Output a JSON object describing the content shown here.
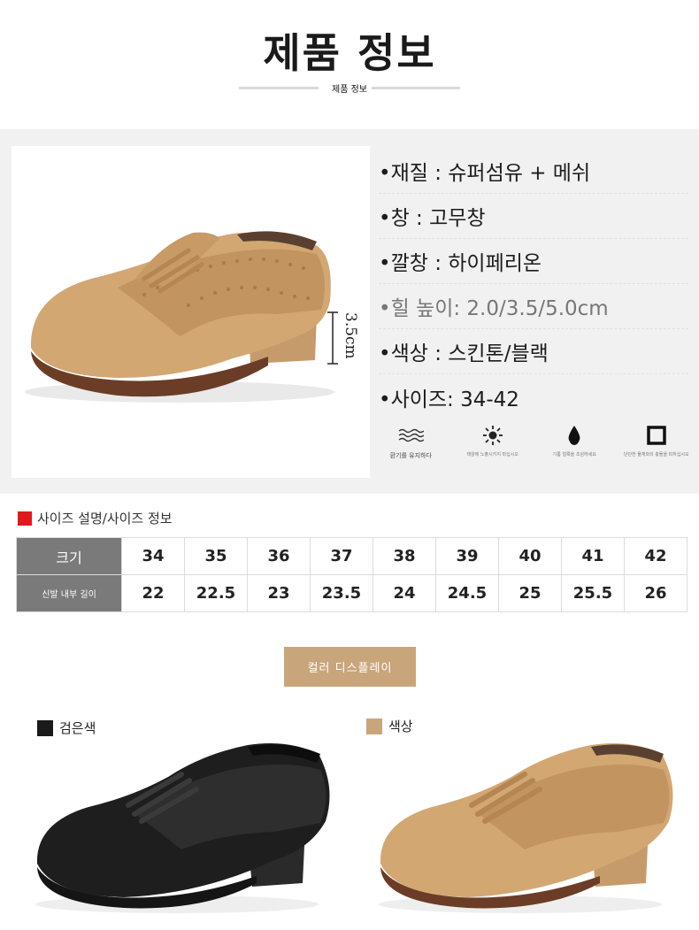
{
  "header": {
    "title": "제품 정보",
    "subtitle": "제품 정보"
  },
  "specs": [
    {
      "label": "•재질 : 슈퍼섬유 + 메쉬",
      "muted": false
    },
    {
      "label": "•창 : 고무창",
      "muted": false
    },
    {
      "label": "•깔창 : 하이페리온",
      "muted": false
    },
    {
      "label": "•힐 높이: 2.0/3.5/5.0cm",
      "muted": true
    },
    {
      "label": "•색상 : 스킨톤/블랙",
      "muted": false
    },
    {
      "label": "•사이즈: 34-42",
      "muted": false
    }
  ],
  "heel_marker": "3.5cm",
  "features": [
    {
      "icon": "ventilation-icon",
      "caption": "환기를 유지하다"
    },
    {
      "icon": "sun-icon",
      "caption": "태양에 노출시키지 마십시오"
    },
    {
      "icon": "water-drop-icon",
      "caption": "기름 얼룩을 조심하세요"
    },
    {
      "icon": "square-icon",
      "caption": "단단한 물체와의 충돌을 피하십시오"
    }
  ],
  "size_section": {
    "heading": "사이즈 설명/사이즈 정보",
    "accent": "#e0191e",
    "row1_label": "크기",
    "row2_label": "신발 내부 길이",
    "sizes": [
      "34",
      "35",
      "36",
      "37",
      "38",
      "39",
      "40",
      "41",
      "42"
    ],
    "lengths": [
      "22",
      "22.5",
      "23",
      "23.5",
      "24",
      "24.5",
      "25",
      "25.5",
      "26"
    ]
  },
  "color_display": {
    "button_label": "컬러 디스플레이",
    "button_color": "#c9a57b",
    "options": [
      {
        "name": "검은색",
        "swatch": "#1a1a1a"
      },
      {
        "name": "색상",
        "swatch": "#c9a57b"
      }
    ]
  }
}
